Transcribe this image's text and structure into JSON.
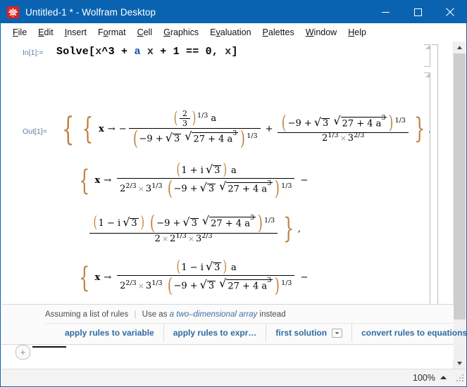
{
  "window": {
    "title": "Untitled-1 * - Wolfram Desktop",
    "icon": "wolfram-spikey-icon",
    "minimize_label": "–",
    "maximize_label": "□",
    "close_label": "✕",
    "accent_color": "#0a63b0"
  },
  "menu": {
    "items": [
      {
        "label": "File",
        "mnemonic": "F"
      },
      {
        "label": "Edit",
        "mnemonic": "E"
      },
      {
        "label": "Insert",
        "mnemonic": "I"
      },
      {
        "label": "Format",
        "mnemonic": "o"
      },
      {
        "label": "Cell",
        "mnemonic": "C"
      },
      {
        "label": "Graphics",
        "mnemonic": "G"
      },
      {
        "label": "Evaluation",
        "mnemonic": "v"
      },
      {
        "label": "Palettes",
        "mnemonic": "P"
      },
      {
        "label": "Window",
        "mnemonic": "W"
      },
      {
        "label": "Help",
        "mnemonic": "H"
      }
    ]
  },
  "notebook": {
    "input_cell": {
      "label": "In[1]:=",
      "code": "Solve[x^3 + a x + 1 == 0, x]",
      "tokens": [
        {
          "text": "Solve[",
          "color": "#000000"
        },
        {
          "text": "x",
          "color": "#2c2c2c"
        },
        {
          "text": "^3 + ",
          "color": "#000000"
        },
        {
          "text": "a",
          "color": "#1d52a8"
        },
        {
          "text": " ",
          "color": "#000000"
        },
        {
          "text": "x",
          "color": "#2c2c2c"
        },
        {
          "text": " + 1 == 0, ",
          "color": "#000000"
        },
        {
          "text": "x",
          "color": "#2c2c2c"
        },
        {
          "text": "]",
          "color": "#000000"
        }
      ]
    },
    "output_cell": {
      "label": "Out[1]=",
      "expression_text": "{{x -> -((2/3)^(1/3) a)/(-9 + Sqrt[3] Sqrt[27 + 4 a^3])^(1/3) + (-9 + Sqrt[3] Sqrt[27 + 4 a^3])^(1/3)/(2^(1/3) 3^(2/3))}, {x -> ((1 + I Sqrt[3]) a)/(2^(2/3) 3^(1/3) (-9 + Sqrt[3] Sqrt[27 + 4 a^3])^(1/3)) - ((1 - I Sqrt[3]) (-9 + Sqrt[3] Sqrt[27 + 4 a^3])^(1/3))/(2 2^(1/3) 3^(2/3))}, {x -> ((1 - I Sqrt[3]) a)/(2^(2/3) 3^(1/3) (-9 + Sqrt[3] Sqrt[27 + 4 a^3])^(1/3)) - ((1 + I Sqrt[3]) (-9 + Sqrt[3] Sqrt[27 + 4 a^3])^(1/3))/(2 2^(1/3) 3^(2/3))}}",
      "bracket_color": "#c08040",
      "symbols": {
        "var": "x",
        "arrow": "→",
        "param": "a",
        "imaginary": "і",
        "radical": "√",
        "times": "×",
        "minus": "−",
        "plus": "+",
        "open_brace": "{",
        "close_brace": "}",
        "open_paren": "(",
        "close_paren": ")",
        "comma": ","
      },
      "terms": {
        "two": "2",
        "three": "3",
        "four": "4",
        "nine": "9",
        "twentyseven": "27",
        "one": "1",
        "exp_1_3": "1/3",
        "exp_2_3": "2/3",
        "cube": "3",
        "a_cubed_base": "a"
      }
    }
  },
  "suggestion_bar": {
    "assumption_prefix": "Assuming a list of rules",
    "separator": "|",
    "use_as_prefix": "Use as",
    "alternative": "a two–dimensional array",
    "use_as_suffix": "instead",
    "actions": [
      {
        "label": "apply rules to variable",
        "has_dropdown": false
      },
      {
        "label": "apply rules to expr…",
        "has_dropdown": false
      },
      {
        "label": "first solution",
        "has_dropdown": true
      },
      {
        "label": "convert rules to equations",
        "has_dropdown": false
      }
    ]
  },
  "insert_row": {
    "add_cell_label": "+"
  },
  "status_bar": {
    "zoom_level": "100%",
    "zoom_caret": "▲"
  },
  "scrollbar": {
    "up_arrow": "▲",
    "down_arrow": "▾"
  }
}
